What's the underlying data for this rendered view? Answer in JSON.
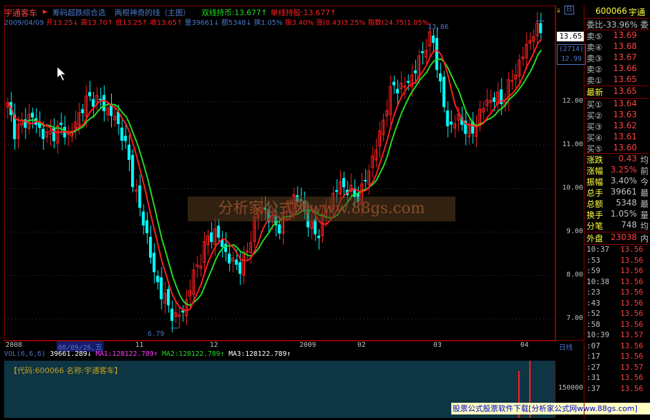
{
  "header": {
    "title": "宇通客车",
    "arrow": "▶",
    "indicator_name": "筹码超跌综合选",
    "formula_name": "两根神奇的线（主图）",
    "dual_line_label": "双线持币:13.677↑",
    "single_line_label": "单线持股:13.677↑",
    "icon_label": "日"
  },
  "info_bar": {
    "date": "2009/04/09",
    "open": "开13.25↓",
    "high": "高13.70↑",
    "low": "低13.25↑",
    "close": "收13.65↑",
    "volume": "量39661↓",
    "amount": "额5348↓",
    "turnover": "换1.05%",
    "amplitude": "振3.40%",
    "change": "涨(0.43)3.25%",
    "index": "指数(24.75)1.05%"
  },
  "annotations": {
    "high_mark": "13.86",
    "low_mark": "6.79",
    "watermark": "分析家公式网www.88gs.com"
  },
  "right_axis": {
    "price_tag": "13.65",
    "count_tag": "(2714)",
    "price_tag2": "12.99",
    "ticks": [
      "12.00",
      "11.00",
      "10.00",
      "9.00",
      "8.00",
      "7.00"
    ]
  },
  "x_axis": {
    "labels": [
      "2008",
      "08/09/26,五",
      "11",
      "12",
      "2009",
      "02",
      "03",
      "04"
    ],
    "period": "日线"
  },
  "volume": {
    "vol_label": "VOL(6,6,6)",
    "vol_value": "39661.289↓",
    "ma1": "MA1:128122.789↑",
    "ma2": "MA2:128122.789↑",
    "ma3": "MA3:128122.789↑",
    "stock_info": "【代码:600066 名称:宇通客车】",
    "axis_tick": "150000",
    "footer_banner": "股票公式股票软件下载[分析家公式网www.88gs.com]"
  },
  "panel": {
    "code": "600066",
    "name": "宇通",
    "weibi": "委比-33.96%",
    "weibi_suffix": "委",
    "sell": [
      {
        "label": "卖⑤",
        "price": "13.69"
      },
      {
        "label": "卖④",
        "price": "13.68"
      },
      {
        "label": "卖③",
        "price": "13.67"
      },
      {
        "label": "卖②",
        "price": "13.66"
      },
      {
        "label": "卖①",
        "price": "13.65"
      }
    ],
    "latest": {
      "label": "最新",
      "price": "13.65"
    },
    "buy": [
      {
        "label": "买①",
        "price": "13.64"
      },
      {
        "label": "买②",
        "price": "13.63"
      },
      {
        "label": "买③",
        "price": "13.62"
      },
      {
        "label": "买④",
        "price": "13.61"
      },
      {
        "label": "买⑤",
        "price": "13.60"
      }
    ],
    "stats": [
      {
        "label": "涨跌",
        "value": "0.43",
        "suffix": "均"
      },
      {
        "label": "涨幅",
        "value": "3.25%",
        "suffix": "前"
      },
      {
        "label": "振幅",
        "value": "3.40%",
        "suffix": "今"
      },
      {
        "label": "总手",
        "value": "39661",
        "suffix": "最"
      },
      {
        "label": "总额",
        "value": "5348",
        "suffix": "最"
      },
      {
        "label": "换手",
        "value": "1.05%",
        "suffix": "量"
      },
      {
        "label": "分笔",
        "value": "748",
        "suffix": "均"
      }
    ],
    "outer": {
      "label": "外盘",
      "value": "23038",
      "suffix": "内"
    },
    "ticks": [
      {
        "time": "10:37",
        "price": "13.56"
      },
      {
        "time": ":53",
        "price": "13.56"
      },
      {
        "time": ":59",
        "price": "13.56"
      },
      {
        "time": "10:38",
        "price": "13.56"
      },
      {
        "time": ":23",
        "price": "13.56"
      },
      {
        "time": ":43",
        "price": "13.56"
      },
      {
        "time": ":52",
        "price": "13.56"
      },
      {
        "time": ":58",
        "price": "13.56"
      },
      {
        "time": "10:39",
        "price": "13.57"
      },
      {
        "time": ":07",
        "price": "13.56"
      },
      {
        "time": ":17",
        "price": "13.56"
      },
      {
        "time": ":27",
        "price": "13.57"
      },
      {
        "time": ":31",
        "price": "13.56"
      },
      {
        "time": ":37",
        "price": "13.56"
      }
    ]
  },
  "chart_data": {
    "type": "candlestick",
    "ylim": [
      6.5,
      14.2
    ],
    "ytick_values": [
      12,
      11,
      10,
      9,
      8,
      7
    ],
    "series": [
      {
        "name": "双线持币",
        "color": "#22dd22"
      },
      {
        "name": "单线持股",
        "color": "#ff2020"
      }
    ],
    "close_path": [
      11.9,
      11.3,
      11.5,
      11.7,
      11.4,
      11.2,
      11.3,
      11.4,
      11.2,
      11.6,
      12.0,
      12.1,
      12.0,
      11.8,
      11.6,
      11.2,
      10.4,
      9.6,
      9.0,
      8.0,
      7.6,
      7.2,
      7.0,
      7.3,
      8.0,
      8.4,
      8.9,
      9.0,
      8.6,
      8.3,
      8.2,
      8.5,
      9.3,
      9.6,
      9.3,
      9.1,
      9.4,
      9.8,
      9.7,
      9.2,
      8.9,
      9.4,
      9.8,
      10.1,
      10.0,
      9.8,
      10.0,
      10.6,
      11.1,
      11.9,
      12.4,
      12.3,
      12.5,
      12.8,
      13.3,
      13.5,
      12.4,
      11.4,
      11.6,
      11.5,
      11.2,
      11.7,
      12.0,
      12.1,
      12.0,
      12.4,
      12.8,
      13.2,
      13.6,
      13.65
    ],
    "colors": {
      "up": "#ff2020",
      "down": "#00ffff",
      "border": "#8a0000",
      "axis_text": "#c0c0c0",
      "blue_text": "#4a78c8",
      "yellow": "#ffff40",
      "panel_red": "#ff4040"
    }
  }
}
